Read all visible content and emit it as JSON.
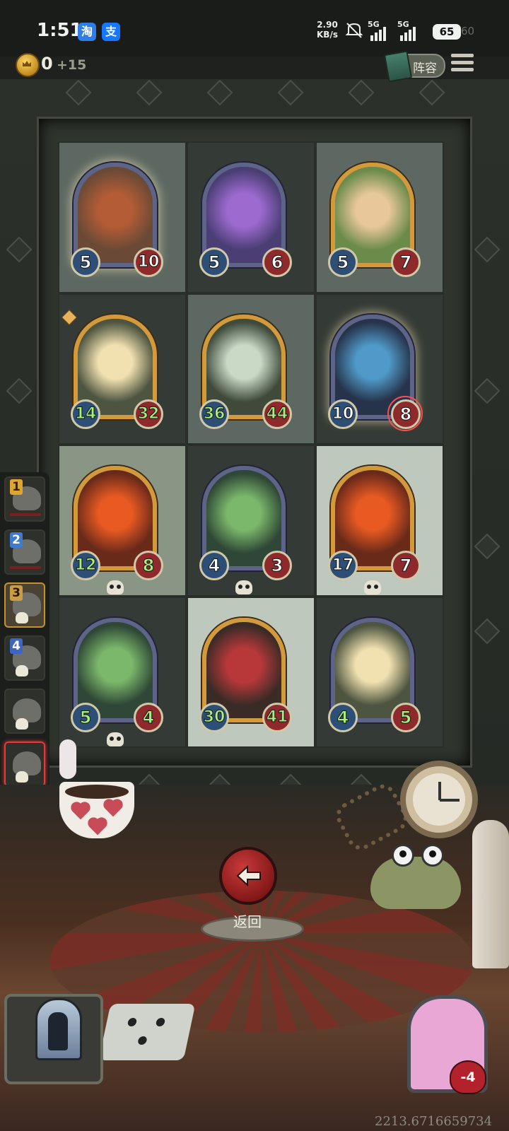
{
  "status_bar": {
    "time": "1:51",
    "app_icon_1": "淘",
    "app_icon_2": "支",
    "net_speed": "2.90",
    "net_unit": "KB/s",
    "sim1": "5G",
    "sim2": "5G",
    "battery": "65",
    "battery_ghost": "60"
  },
  "hud": {
    "gold": "0",
    "gold_income": "+15",
    "lineup_label": "阵容"
  },
  "board": {
    "cells": [
      {
        "shade": "light",
        "frame": "silver",
        "glow": true,
        "attack": "5",
        "health": "10",
        "hp_green": false,
        "skull": false,
        "target": false,
        "star": false,
        "art": "mech-creature"
      },
      {
        "shade": "dark",
        "frame": "silver",
        "glow": false,
        "attack": "5",
        "health": "6",
        "hp_green": false,
        "skull": false,
        "target": false,
        "star": false,
        "art": "flower-dryad"
      },
      {
        "shade": "light",
        "frame": "gold",
        "glow": false,
        "attack": "5",
        "health": "7",
        "hp_green": false,
        "skull": false,
        "target": false,
        "star": false,
        "art": "fairy-on-log"
      },
      {
        "shade": "dark",
        "frame": "gold",
        "glow": false,
        "attack": "14",
        "health": "32",
        "hp_green": true,
        "skull": false,
        "target": false,
        "star": true,
        "art": "blonde-elf"
      },
      {
        "shade": "light",
        "frame": "gold",
        "glow": false,
        "attack": "36",
        "health": "44",
        "hp_green": true,
        "skull": false,
        "target": false,
        "star": false,
        "art": "sprout-spirit"
      },
      {
        "shade": "dark",
        "frame": "silver",
        "glow": true,
        "attack": "10",
        "health": "8",
        "hp_green": false,
        "skull": false,
        "target": true,
        "star": false,
        "art": "crystal-crab"
      },
      {
        "shade": "sage",
        "frame": "gold",
        "glow": false,
        "attack": "12",
        "health": "8",
        "hp_green": true,
        "skull": true,
        "target": false,
        "star": false,
        "art": "fire-fairy"
      },
      {
        "shade": "dark",
        "frame": "silver",
        "glow": false,
        "attack": "4",
        "health": "3",
        "hp_green": false,
        "skull": true,
        "target": false,
        "star": false,
        "art": "maid-dryad"
      },
      {
        "shade": "pale",
        "frame": "gold",
        "glow": false,
        "attack": "17",
        "health": "7",
        "hp_green": false,
        "skull": true,
        "target": false,
        "star": false,
        "art": "fire-fairy"
      },
      {
        "shade": "dark",
        "frame": "silver",
        "glow": false,
        "attack": "5",
        "health": "4",
        "hp_green": true,
        "skull": true,
        "target": false,
        "star": false,
        "art": "maid-dryad"
      },
      {
        "shade": "pale",
        "frame": "gold",
        "glow": false,
        "attack": "30",
        "health": "41",
        "hp_green": true,
        "skull": false,
        "target": false,
        "star": false,
        "art": "rose-witch"
      },
      {
        "shade": "dark",
        "frame": "silver",
        "glow": false,
        "attack": "4",
        "health": "5",
        "hp_green": true,
        "skull": false,
        "target": false,
        "star": false,
        "art": "blonde-elf"
      }
    ]
  },
  "turn_order": [
    {
      "num": "1",
      "skull": false,
      "active": false,
      "gold": false
    },
    {
      "num": "2",
      "skull": false,
      "active": false,
      "gold": false
    },
    {
      "num": "3",
      "skull": true,
      "active": false,
      "gold": true
    },
    {
      "num": "4",
      "skull": true,
      "active": false,
      "gold": false
    },
    {
      "num": "",
      "skull": true,
      "active": false,
      "gold": false
    },
    {
      "num": "",
      "skull": true,
      "active": true,
      "gold": false
    },
    {
      "num": "",
      "skull": true,
      "active": false,
      "gold": false
    },
    {
      "num": "",
      "skull": true,
      "active": false,
      "gold": false
    }
  ],
  "back_button": {
    "label": "返回"
  },
  "opponent": {
    "health": "-4"
  },
  "debug": {
    "value": "2213.6716659734"
  }
}
